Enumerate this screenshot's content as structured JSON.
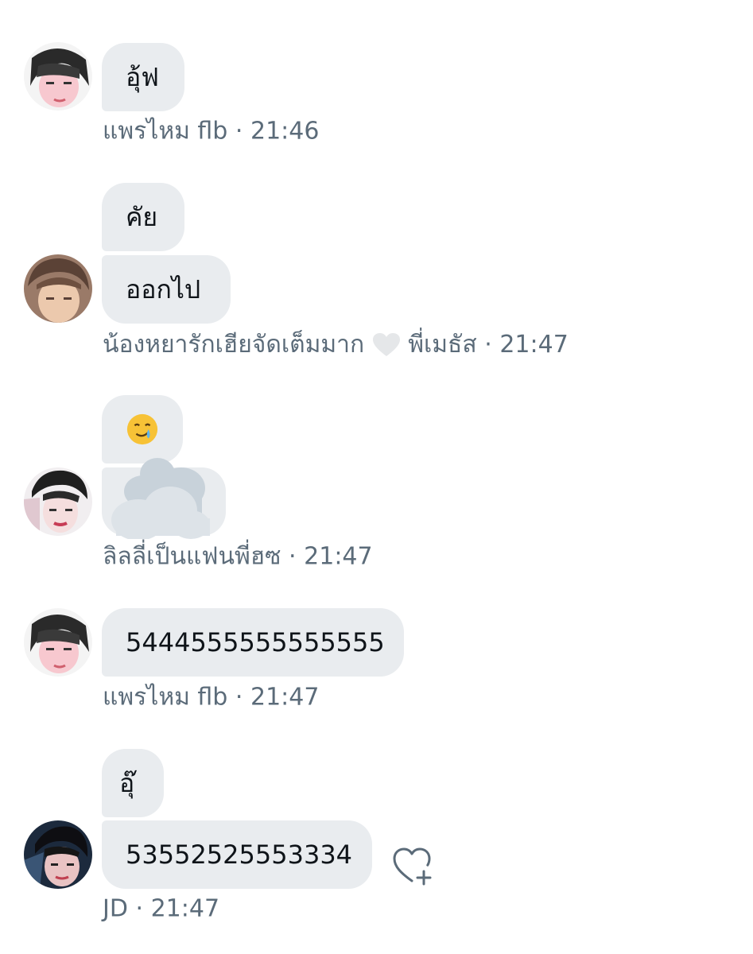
{
  "messages": [
    {
      "author": "แพรไหม flb",
      "time": "21:46",
      "bubbles": [
        "อุ้ฟ"
      ]
    },
    {
      "author_prefix": "น้องหยารักเฮียจัดเต็มมาก",
      "author_suffix": "พี่เมธัส",
      "time": "21:47",
      "bubbles": [
        "คัย",
        "ออกไป"
      ]
    },
    {
      "author": "ลิลลี่เป็นแฟนพี่ฮซ",
      "time": "21:47",
      "bubbles": [
        "smiling-face-with-tear-emoji",
        "cloud-emoji"
      ]
    },
    {
      "author": "แพรไหม flb",
      "time": "21:47",
      "bubbles": [
        "5444555555555555"
      ]
    },
    {
      "author": "JD",
      "time": "21:47",
      "bubbles": [
        "อุ๊",
        "53552525553334"
      ]
    }
  ],
  "separator": "·",
  "colors": {
    "bubble": "#e9ecef",
    "meta_text": "#5b6b79",
    "text": "#0f1419"
  }
}
